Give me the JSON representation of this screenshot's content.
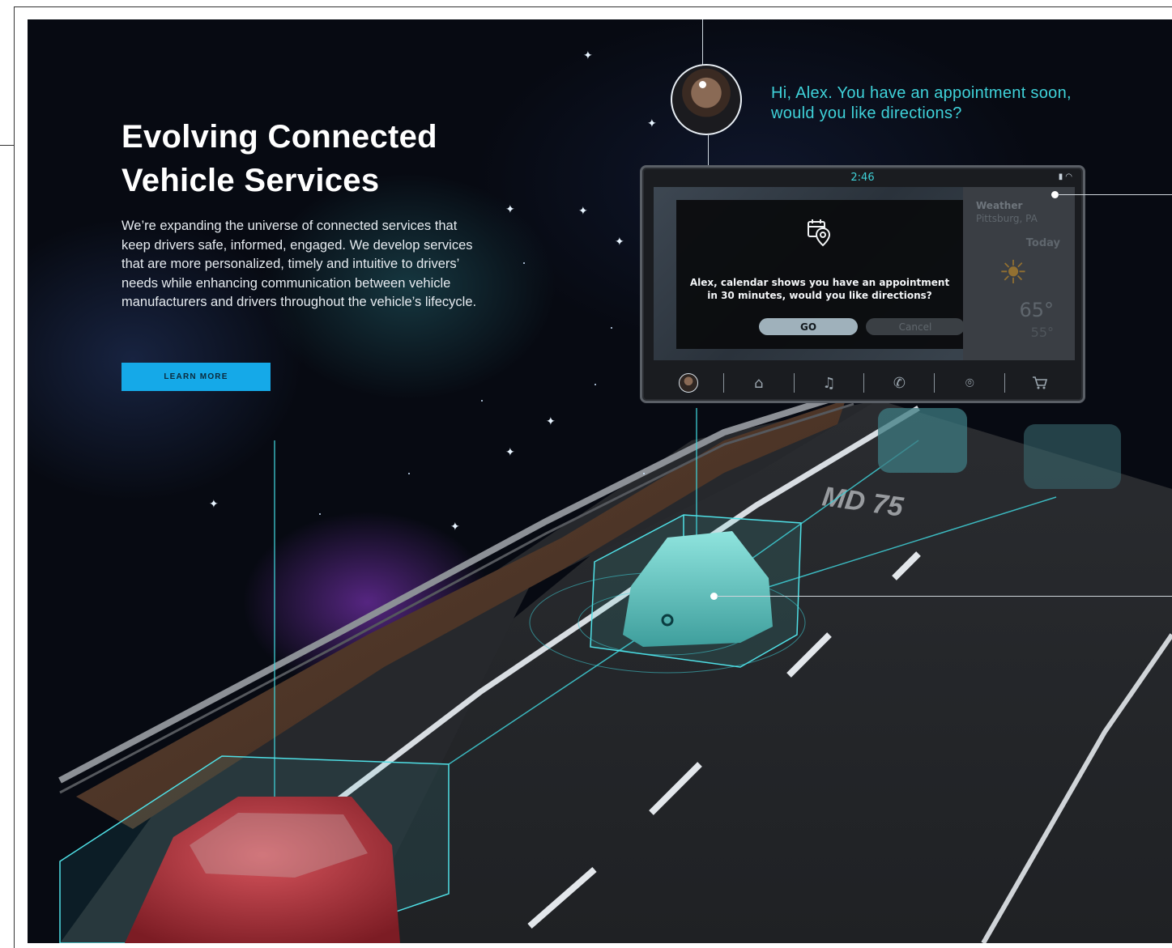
{
  "hero": {
    "headline_line1": "Evolving Connected",
    "headline_line2": "Vehicle Services",
    "body": "We’re expanding the universe of connected services that keep drivers safe, informed, engaged. We develop services that are more personalized, timely and intuitive to drivers’ needs while enhancing communication between vehicle manufacturers and drivers throughout the vehicle’s lifecycle.",
    "cta_label": "LEARN MORE"
  },
  "assistant": {
    "greeting": "Hi, Alex. You have an appointment soon, would you like directions?"
  },
  "screen": {
    "clock": "2:46",
    "status_icons": [
      "signal-icon",
      "wifi-icon"
    ],
    "weather": {
      "title": "Weather",
      "location": "Pittsburg, PA",
      "day": "Today",
      "icon": "sun-icon",
      "high": "65°",
      "low": "55°"
    },
    "dialog": {
      "icon": "calendar-location-icon",
      "message": "Alex, calendar shows you have an appointment in 30 minutes, would you like directions?",
      "go_label": "GO",
      "cancel_label": "Cancel"
    },
    "nav_items": [
      "profile-avatar",
      "home-icon",
      "music-icon",
      "phone-icon",
      "location-pin-icon",
      "cart-icon"
    ]
  },
  "scene": {
    "road_marking": "MD 75",
    "colors": {
      "accent_cyan": "#3fd2d9",
      "cta_blue": "#15a9e8",
      "space_bg": "#070a12"
    }
  }
}
